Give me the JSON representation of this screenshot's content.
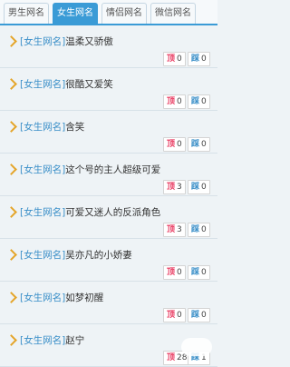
{
  "tabs": [
    {
      "label": "男生网名",
      "active": false
    },
    {
      "label": "女生网名",
      "active": true
    },
    {
      "label": "情侣网名",
      "active": false
    },
    {
      "label": "微信网名",
      "active": false
    }
  ],
  "vote_up_label": "顶",
  "vote_down_label": "踩",
  "items": [
    {
      "tag": "[女生网名]",
      "name": "温柔又骄傲",
      "up": "0",
      "down": "0"
    },
    {
      "tag": "[女生网名]",
      "name": "很酷又爱笑",
      "up": "0",
      "down": "0"
    },
    {
      "tag": "[女生网名]",
      "name": "含笑",
      "up": "0",
      "down": "0"
    },
    {
      "tag": "[女生网名]",
      "name": "这个号的主人超级可爱",
      "up": "3",
      "down": "0"
    },
    {
      "tag": "[女生网名]",
      "name": "可爱又迷人的反派角色",
      "up": "3",
      "down": "0"
    },
    {
      "tag": "[女生网名]",
      "name": "吴亦凡的小娇妻",
      "up": "0",
      "down": "0"
    },
    {
      "tag": "[女生网名]",
      "name": "如梦初醒",
      "up": "0",
      "down": "0"
    },
    {
      "tag": "[女生网名]",
      "name": "赵宁",
      "up": "28",
      "down": "1"
    }
  ],
  "colors": {
    "accent": "#3a9bd6",
    "tag": "#3a8fc8",
    "arrow": "#e4a52a",
    "up": "#e8365d"
  }
}
